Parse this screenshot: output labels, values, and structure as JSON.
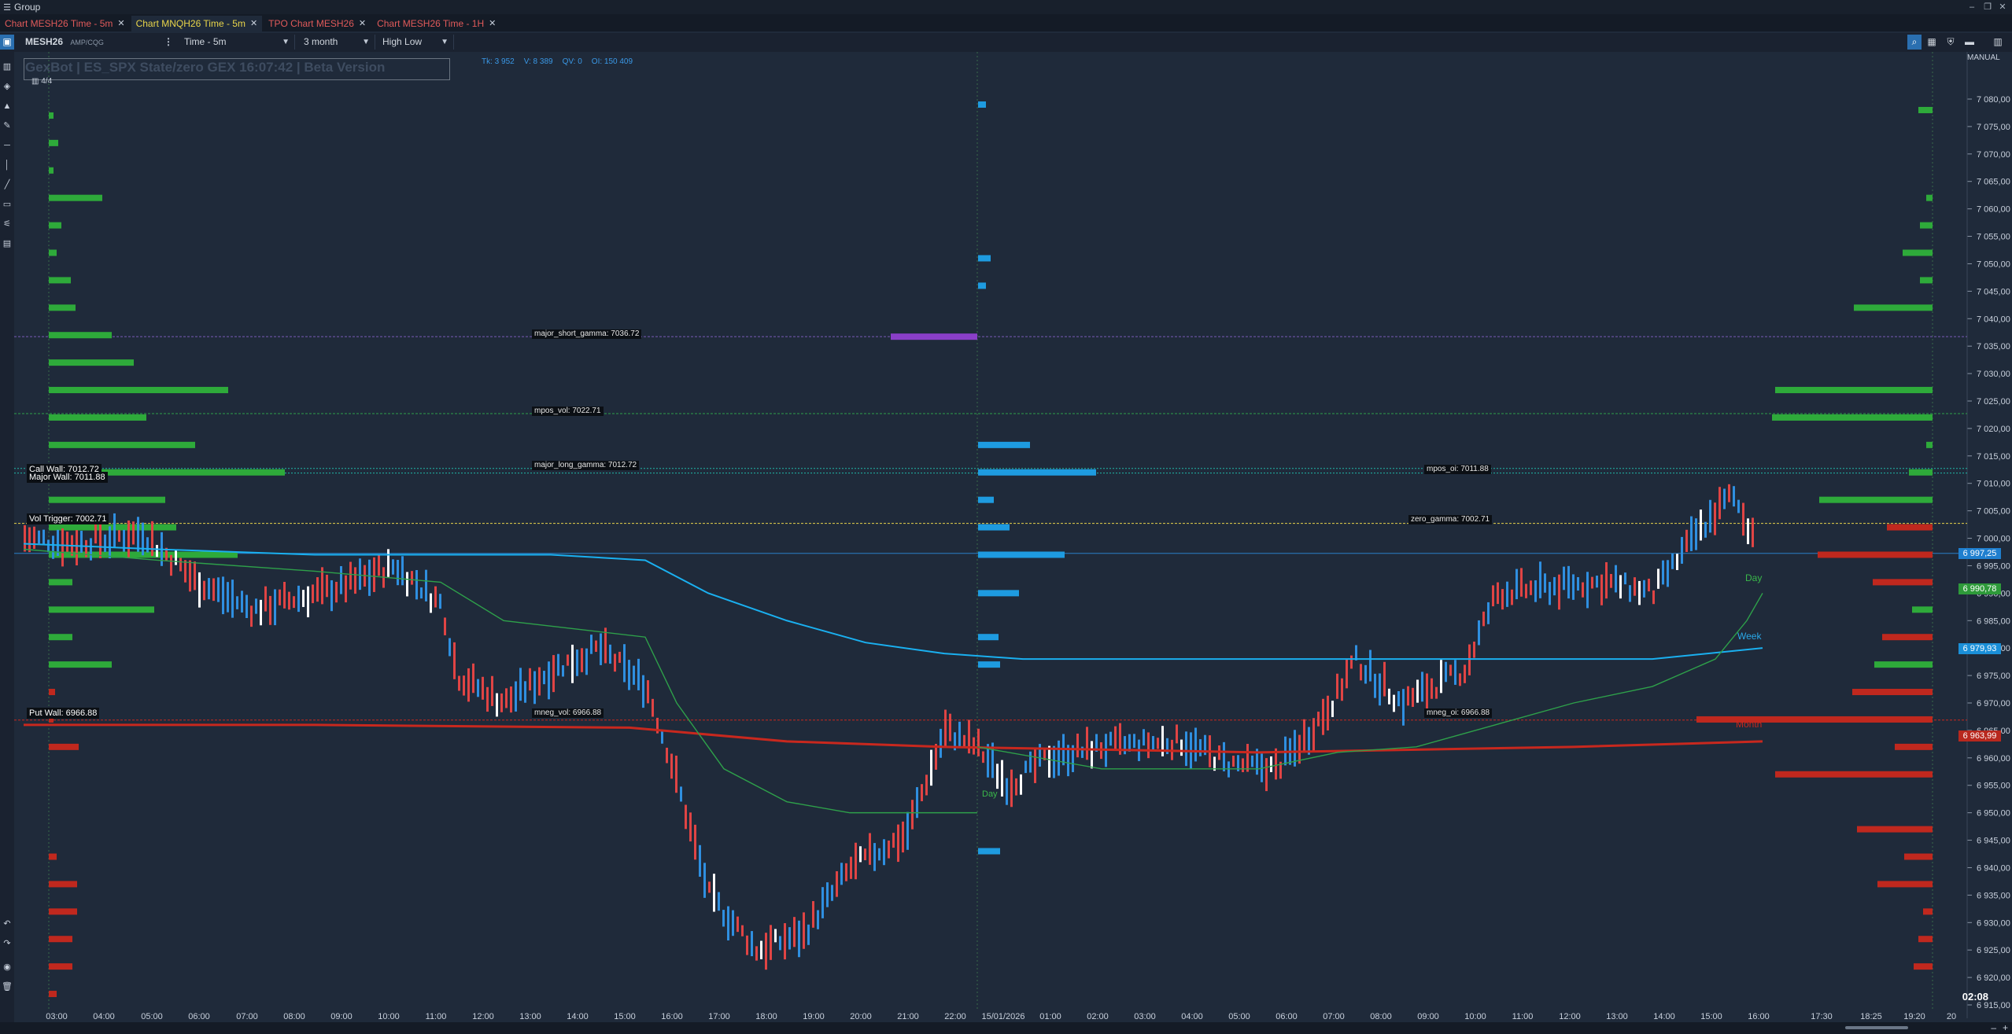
{
  "window": {
    "title": "Group"
  },
  "tabs": [
    {
      "label": "Chart MESH26 Time - 5m",
      "color": "#e05a5a",
      "active": false
    },
    {
      "label": "Chart MNQH26 Time - 5m",
      "color": "#e8d44a",
      "active": true
    },
    {
      "label": "TPO Chart MESH26",
      "color": "#e05a5a",
      "active": false
    },
    {
      "label": "Chart MESH26 Time - 1H",
      "color": "#e05a5a",
      "active": false
    }
  ],
  "toolbar": {
    "symbol": "MESH26",
    "exchange": "AMP/CQG",
    "timeframe": "Time - 5m",
    "range": "3 month",
    "chart_style": "High Low",
    "scale_mode": "MANUAL"
  },
  "overlay": {
    "watermark": "GexBot | ES_SPX State/zero GEX 16:07:42 | Beta Version",
    "counter": "4/4"
  },
  "infobar": {
    "items": [
      "Tk: 3 952",
      "V: 8 389",
      "QV: 0",
      "OI: 150 409"
    ]
  },
  "levels": {
    "major_short_gamma": "major_short_gamma: 7036.72",
    "mpos_vol": "mpos_vol: 7022.71",
    "major_long_gamma": "major_long_gamma: 7012.72",
    "mpos_oi": "mpos_oi: 7011.88",
    "zero_gamma": "zero_gamma: 7002.71",
    "mneg_vol": "mneg_vol: 6966.88",
    "mneg_oi": "mneg_oi: 6966.88",
    "call_wall": "Call Wall: 7012.72",
    "major_wall": "Major Wall: 7011.88",
    "vol_trigger": "Vol Trigger: 7002.71",
    "put_wall": "Put Wall: 6966.88"
  },
  "indicator_labels": {
    "day": "Day",
    "week": "Week",
    "month": "Month",
    "day_left": "Day"
  },
  "price_axis": {
    "ticks": [
      "7 080,00",
      "7 075,00",
      "7 070,00",
      "7 065,00",
      "7 060,00",
      "7 055,00",
      "7 050,00",
      "7 045,00",
      "7 040,00",
      "7 035,00",
      "7 030,00",
      "7 025,00",
      "7 020,00",
      "7 015,00",
      "7 010,00",
      "7 005,00",
      "7 000,00",
      "6 995,00",
      "6 990,00",
      "6 985,00",
      "6 980,00",
      "6 975,00",
      "6 970,00",
      "6 965,00",
      "6 960,00",
      "6 955,00",
      "6 950,00",
      "6 945,00",
      "6 940,00",
      "6 935,00",
      "6 930,00",
      "6 925,00",
      "6 920,00",
      "6 915,00"
    ],
    "tags": [
      {
        "value": "6 997,25",
        "color": "#1f7fcf"
      },
      {
        "value": "6 990,78",
        "color": "#2e9a3a"
      },
      {
        "value": "6 979,93",
        "color": "#1a8fd8"
      },
      {
        "value": "6 963,99",
        "color": "#b8281e"
      }
    ]
  },
  "time_axis": {
    "ticks": [
      "03:00",
      "04:00",
      "05:00",
      "06:00",
      "07:00",
      "08:00",
      "09:00",
      "10:00",
      "11:00",
      "12:00",
      "13:00",
      "14:00",
      "15:00",
      "16:00",
      "17:00",
      "18:00",
      "19:00",
      "20:00",
      "21:00",
      "22:00",
      "15/01/2026",
      "01:00",
      "02:00",
      "03:00",
      "04:00",
      "05:00",
      "06:00",
      "07:00",
      "08:00",
      "09:00",
      "10:00",
      "11:00",
      "12:00",
      "13:00",
      "14:00",
      "15:00",
      "16:00",
      "17:30",
      "18:25",
      "19:20",
      "20"
    ]
  },
  "clock": "02:08",
  "colors": {
    "bg": "#1f2a3a",
    "up": "#2f8fe0",
    "down": "#e04444",
    "doji": "#ffffff",
    "green_bar": "#2eaa3a",
    "red_bar": "#c0281e",
    "blue_bar": "#1e9be0",
    "purple": "#8a3fc8"
  }
}
